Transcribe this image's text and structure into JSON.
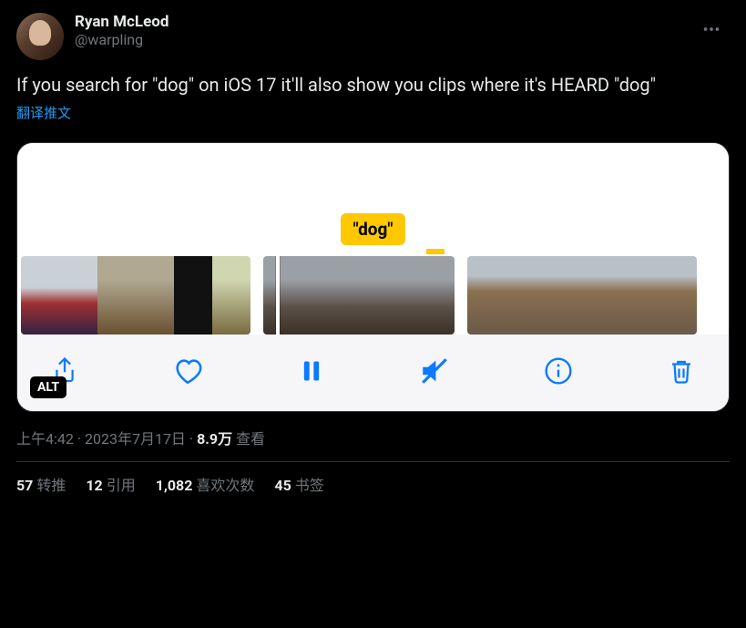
{
  "user": {
    "display_name": "Ryan McLeod",
    "handle": "@warpling"
  },
  "tweet_text": "If you search for \"dog\" on iOS 17 it'll also show you clips where it's HEARD \"dog\"",
  "translate_label": "翻译推文",
  "media": {
    "search_tag": "\"dog\"",
    "alt_badge": "ALT"
  },
  "meta": {
    "time": "上午4:42",
    "sep1": " · ",
    "date": "2023年7月17日",
    "sep2": " · ",
    "views_value": "8.9万",
    "views_label": " 查看"
  },
  "stats": {
    "retweets_count": "57",
    "retweets_label": "转推",
    "quotes_count": "12",
    "quotes_label": "引用",
    "likes_count": "1,082",
    "likes_label": "喜欢次数",
    "bookmarks_count": "45",
    "bookmarks_label": "书签"
  }
}
